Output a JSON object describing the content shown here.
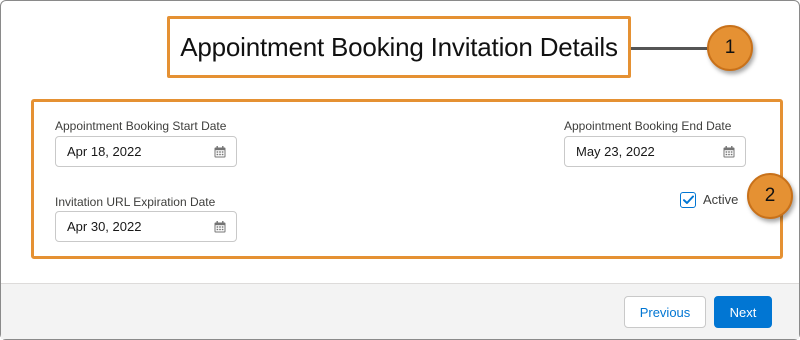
{
  "header": {
    "title": "Appointment Booking Invitation Details"
  },
  "callouts": [
    "1",
    "2"
  ],
  "fields": {
    "start_date": {
      "label": "Appointment Booking Start Date",
      "value": "Apr 18, 2022"
    },
    "end_date": {
      "label": "Appointment Booking End Date",
      "value": "May 23, 2022"
    },
    "expiration_date": {
      "label": "Invitation URL Expiration Date",
      "value": "Apr 30, 2022"
    },
    "active": {
      "label": "Active",
      "checked": true
    }
  },
  "footer": {
    "previous_label": "Previous",
    "next_label": "Next"
  },
  "colors": {
    "highlight": "#e59133",
    "brand": "#0176d3",
    "footer_bg": "#f3f3f3"
  },
  "icons": [
    "calendar-icon",
    "checkmark-icon"
  ]
}
